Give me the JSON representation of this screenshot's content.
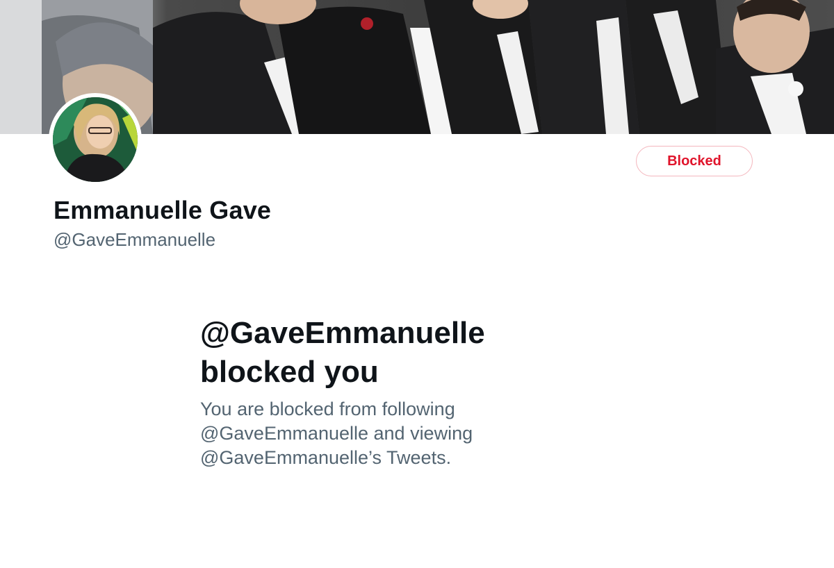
{
  "banner": {
    "icon": "banner-photo"
  },
  "profile": {
    "avatar_icon": "profile-avatar",
    "display_name": "Emmanuelle Gave",
    "handle": "@GaveEmmanuelle",
    "action_button": {
      "label": "Blocked",
      "color": "#e0142b",
      "border_color": "#f4b6bd"
    }
  },
  "blocked_notice": {
    "title_line1": "@GaveEmmanuelle",
    "title_line2": "blocked you",
    "desc_line1": "You are blocked from following",
    "desc_line2": "@GaveEmmanuelle and viewing",
    "desc_line3": "@GaveEmmanuelle’s Tweets."
  },
  "colors": {
    "primary_text": "#0f1419",
    "secondary_text": "#536471",
    "background": "#ffffff"
  }
}
